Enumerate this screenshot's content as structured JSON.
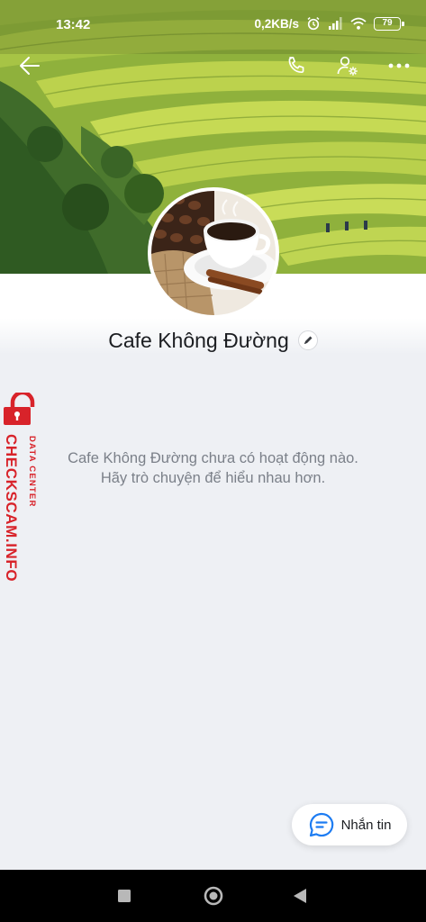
{
  "status_bar": {
    "time": "13:42",
    "network_speed": "0,2KB/s",
    "battery": "79",
    "icons": [
      "alarm-icon",
      "signal-icon",
      "wifi-icon",
      "battery-icon"
    ]
  },
  "header": {
    "back_icon": "arrow-left-icon",
    "call_icon": "phone-icon",
    "settings_icon": "user-settings-icon",
    "more_icon": "more-dots-icon"
  },
  "profile": {
    "name": "Cafe Không Đường",
    "edit_icon": "pencil-icon"
  },
  "feed": {
    "empty_line1": "Cafe Không Đường chưa có hoạt động nào.",
    "empty_line2": "Hãy trò chuyện để hiểu nhau hơn."
  },
  "watermark": {
    "top_text": "DATA CENTER",
    "main_text": "CHECKSCAM.INFO",
    "color": "#d8232a"
  },
  "message_button": {
    "label": "Nhắn tin",
    "icon": "chat-bubble-icon",
    "accent": "#1d7cf2"
  },
  "android_nav": {
    "buttons": [
      "recents-square-icon",
      "home-circle-icon",
      "back-triangle-icon"
    ]
  }
}
